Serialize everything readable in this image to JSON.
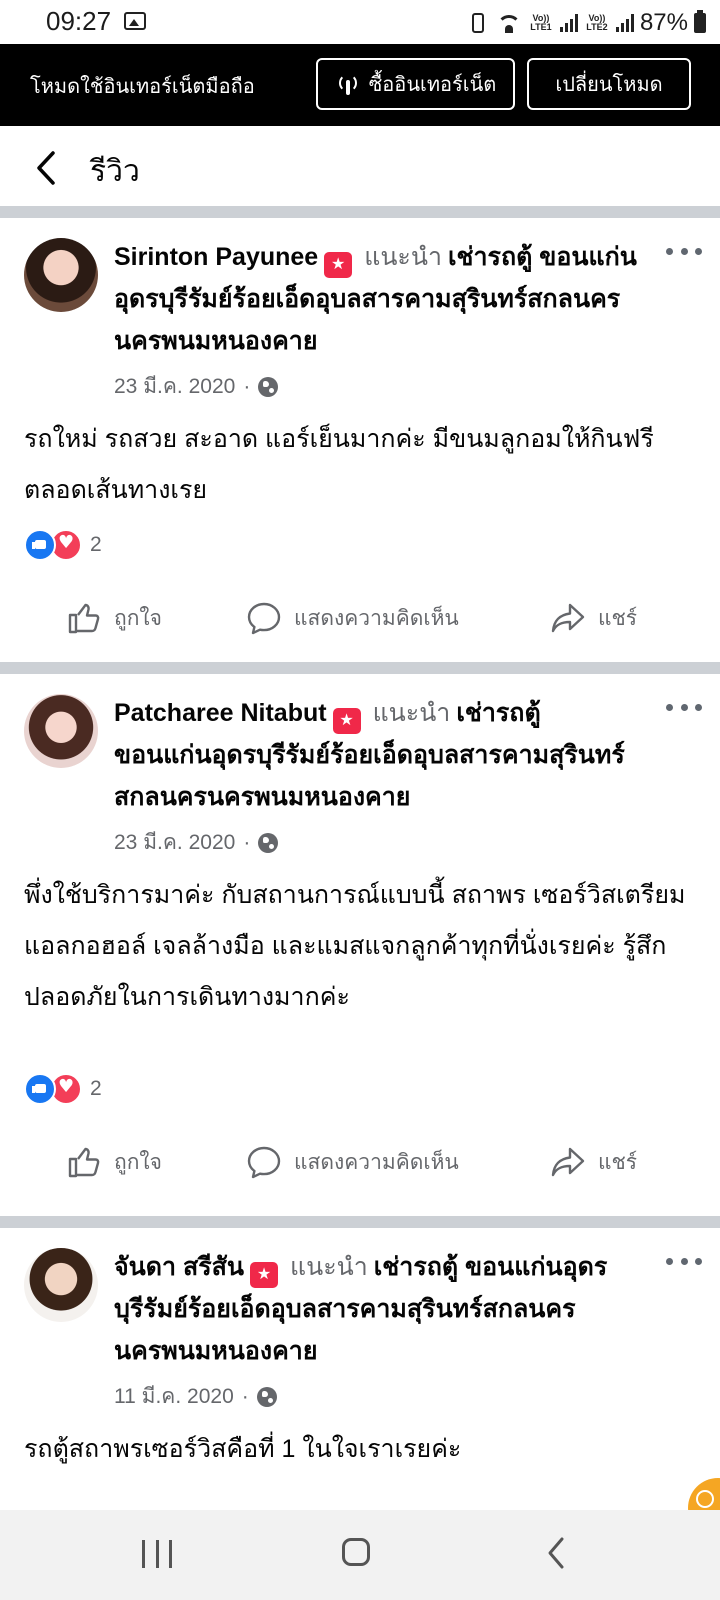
{
  "status_bar": {
    "time": "09:27",
    "lte1": "Vo)) LTE1",
    "lte2": "Vo)) LTE2",
    "battery": "87%",
    "icons": [
      "gallery-icon",
      "battery-saver-icon",
      "wifi-icon",
      "signal-icon",
      "battery-icon"
    ]
  },
  "mode_banner": {
    "text": "โหมดใช้อินเทอร์เน็ตมือถือ",
    "buy_label": "ซื้ออินเทอร์เน็ต",
    "switch_label": "เปลี่ยนโหมด"
  },
  "header": {
    "title": "รีวิว"
  },
  "reviews": [
    {
      "author": "Sirinton Payunee",
      "recommends": "แนะนำ",
      "page": "เช่ารถตู้ ขอนแก่นอุดรบุรีรัมย์ร้อยเอ็ดอุบลสารคามสุรินทร์สกลนครนครพนมหนองคาย",
      "date": "23 มี.ค. 2020",
      "dot": "·",
      "text": "รถใหม่ รถสวย สะอาด แอร์เย็นมากค่ะ มีขนมลูกอมให้กินฟรีตลอดเส้นทางเรย",
      "reaction_count": "2"
    },
    {
      "author": "Patcharee Nitabut",
      "recommends": "แนะนำ",
      "page": "เช่ารถตู้ ขอนแก่นอุดรบุรีรัมย์ร้อยเอ็ดอุบลสารคามสุรินทร์สกลนครนครพนมหนองคาย",
      "date": "23 มี.ค. 2020",
      "dot": "·",
      "text": "พึ่งใช้บริการมาค่ะ กับสถานการณ์แบบนี้ สถาพร เซอร์วิสเตรียมแอลกอฮอล์ เจลล้างมือ และแมสแจกลูกค้าทุกที่นั่งเรยค่ะ รู้สึกปลอดภัยในการเดินทางมากค่ะ",
      "reaction_count": "2"
    },
    {
      "author": "จันดา สรีสัน",
      "recommends": "แนะนำ",
      "page": "เช่ารถตู้ ขอนแก่นอุดรบุรีรัมย์ร้อยเอ็ดอุบลสารคามสุรินทร์สกลนครนครพนมหนองคาย",
      "date": "11 มี.ค. 2020",
      "dot": "·",
      "text": "รถตู้สถาพรเซอร์วิสคือที่ 1 ในใจเราเรยค่ะ"
    }
  ],
  "actions": {
    "like": "ถูกใจ",
    "comment": "แสดงความคิดเห็น",
    "share": "แชร์"
  },
  "colors": {
    "banner_bg": "#000000",
    "divider": "#ccd0d5",
    "like_blue": "#1877f2",
    "love_red": "#f33e58",
    "recommend_red": "#f02849",
    "secondary_text": "#65676b"
  }
}
